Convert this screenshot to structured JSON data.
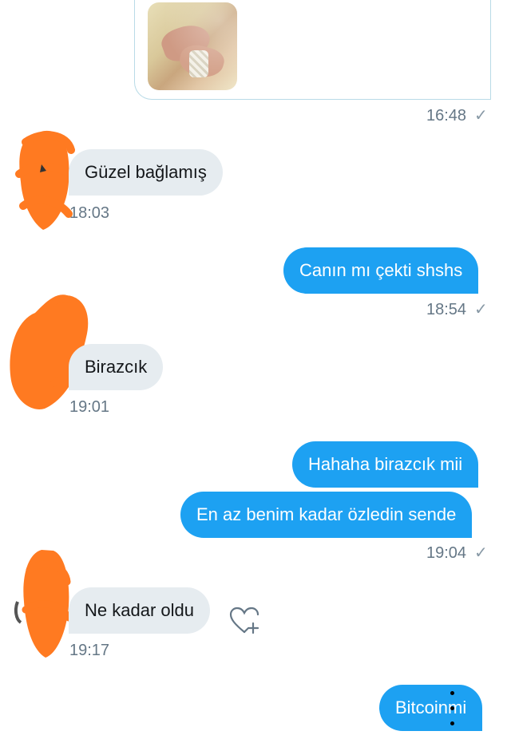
{
  "messages": [
    {
      "kind": "sent-media",
      "time": "16:48"
    },
    {
      "kind": "received",
      "text": "Güzel bağlamış",
      "time": "18:03"
    },
    {
      "kind": "sent",
      "text": "Canın mı çekti shshs",
      "time": "18:54"
    },
    {
      "kind": "received",
      "text": "Birazcık",
      "time": "19:01"
    },
    {
      "kind": "sent",
      "text": "Hahaha birazcık mii"
    },
    {
      "kind": "sent",
      "text": "En az benim kadar özledin sende",
      "time": "19:04"
    },
    {
      "kind": "received",
      "text": "Ne kadar oldu",
      "time": "19:17"
    },
    {
      "kind": "sent",
      "text": "Bitcoinmi"
    }
  ],
  "icons": {
    "read_check": "check-icon",
    "like": "heart-plus-icon",
    "more": "more-vertical-icon",
    "avatar": "redacted-avatar"
  },
  "colors": {
    "sent_bubble": "#1da1f2",
    "received_bubble": "#e6ecf0",
    "timestamp": "#657786",
    "redaction": "#ff7a21"
  }
}
